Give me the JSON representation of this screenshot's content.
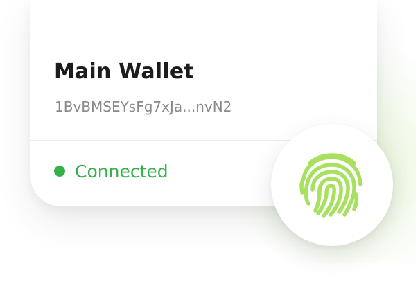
{
  "wallet": {
    "name": "Main Wallet",
    "address": "1BvBMSEYsFg7xJa...nvN2"
  },
  "status": {
    "label": "Connected",
    "color": "#33b24a"
  },
  "fingerprint": {
    "icon": "fingerprint-icon",
    "color": "#a8e05f"
  }
}
